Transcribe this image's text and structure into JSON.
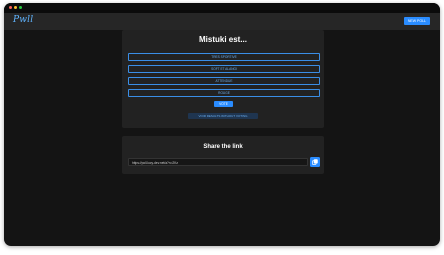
{
  "window": {
    "controls": [
      {
        "name": "close",
        "color": "#ff5f56"
      },
      {
        "name": "minimize",
        "color": "#ffbd2e"
      },
      {
        "name": "maximize",
        "color": "#27c93f"
      }
    ]
  },
  "header": {
    "logo": "Pwll",
    "new_poll_label": "NEW POLL"
  },
  "poll": {
    "question": "Mistuki est...",
    "options": [
      {
        "label": "TRES SPORTIVE"
      },
      {
        "label": "SOFT ET ALANGI"
      },
      {
        "label": "ATTENDUE"
      },
      {
        "label": "ROUGE"
      }
    ],
    "vote_label": "VOTE",
    "results_label": "VOIR RESULTS WITHOUT VOTING"
  },
  "share": {
    "title": "Share the link",
    "link": "https://poll.lucy-dev.net/a?n=2Kz"
  },
  "colors": {
    "accent": "#2a8cff",
    "background": "#141414",
    "card": "#222222",
    "appbar": "#262626"
  }
}
